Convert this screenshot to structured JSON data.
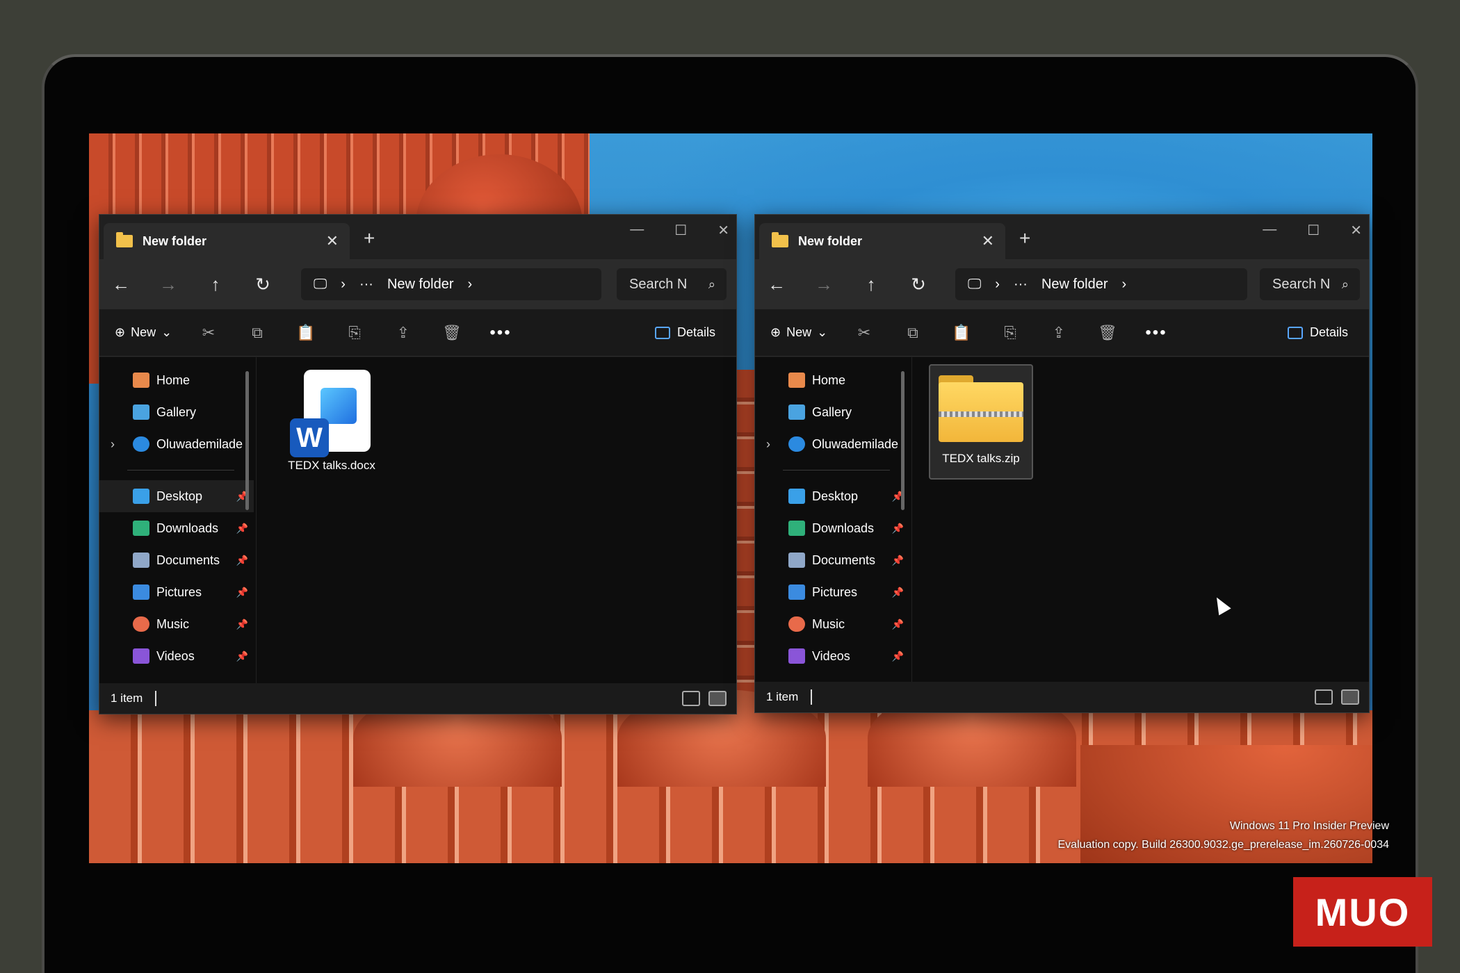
{
  "windows": [
    {
      "tab_title": "New folder",
      "address_crumb": "New folder",
      "search_placeholder": "Search N",
      "toolbar": {
        "new_label": "New",
        "details_label": "Details"
      },
      "sidebar": [
        {
          "label": "Home",
          "icon": "home-icon"
        },
        {
          "label": "Gallery",
          "icon": "gallery-icon"
        },
        {
          "label": "Oluwademilade",
          "icon": "onedrive-icon"
        },
        {
          "label": "Desktop",
          "icon": "desktop-icon"
        },
        {
          "label": "Downloads",
          "icon": "downloads-icon"
        },
        {
          "label": "Documents",
          "icon": "documents-icon"
        },
        {
          "label": "Pictures",
          "icon": "pictures-icon"
        },
        {
          "label": "Music",
          "icon": "music-icon"
        },
        {
          "label": "Videos",
          "icon": "videos-icon"
        }
      ],
      "file": {
        "name": "TEDX talks.docx",
        "icon": "word-document-icon"
      },
      "status": "1 item"
    },
    {
      "tab_title": "New folder",
      "address_crumb": "New folder",
      "search_placeholder": "Search N",
      "toolbar": {
        "new_label": "New",
        "details_label": "Details"
      },
      "sidebar": [
        {
          "label": "Home",
          "icon": "home-icon"
        },
        {
          "label": "Gallery",
          "icon": "gallery-icon"
        },
        {
          "label": "Oluwademilade",
          "icon": "onedrive-icon"
        },
        {
          "label": "Desktop",
          "icon": "desktop-icon"
        },
        {
          "label": "Downloads",
          "icon": "downloads-icon"
        },
        {
          "label": "Documents",
          "icon": "documents-icon"
        },
        {
          "label": "Pictures",
          "icon": "pictures-icon"
        },
        {
          "label": "Music",
          "icon": "music-icon"
        },
        {
          "label": "Videos",
          "icon": "videos-icon"
        }
      ],
      "file": {
        "name": "TEDX talks.zip",
        "icon": "zip-folder-icon"
      },
      "status": "1 item"
    }
  ],
  "desktop_watermark": {
    "line1": "Windows 11 Pro Insider Preview",
    "line2": "Evaluation copy. Build 26300.9032.ge_prerelease_im.260726-0034"
  },
  "brand_logo": "MUO",
  "colors": {
    "folder": "#f2c14b",
    "accent": "#58a6ff",
    "brand": "#c7211a"
  }
}
